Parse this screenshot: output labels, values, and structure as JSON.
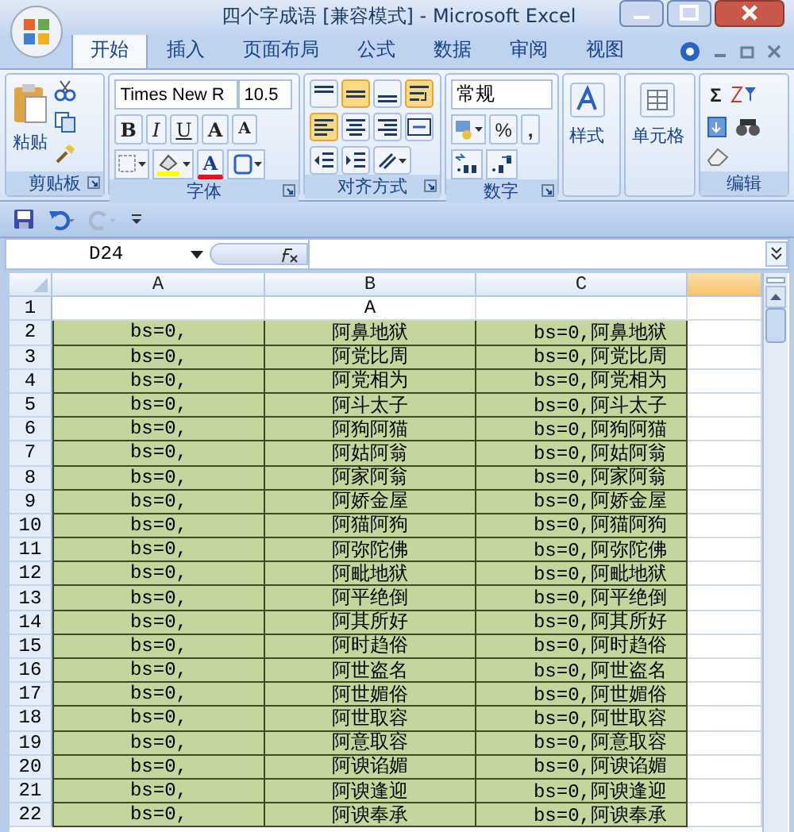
{
  "window": {
    "title": "四个字成语  [兼容模式] - Microsoft Excel"
  },
  "tabs": [
    {
      "label": "开始",
      "selected": true
    },
    {
      "label": "插入",
      "selected": false
    },
    {
      "label": "页面布局",
      "selected": false
    },
    {
      "label": "公式",
      "selected": false
    },
    {
      "label": "数据",
      "selected": false
    },
    {
      "label": "审阅",
      "selected": false
    },
    {
      "label": "视图",
      "selected": false
    }
  ],
  "ribbon": {
    "clipboard": {
      "paste": "粘贴",
      "label": "剪贴板"
    },
    "font": {
      "name": "Times New R",
      "size": "10.5",
      "styles": [
        "B",
        "I",
        "U"
      ],
      "grow": "A",
      "shrink": "A",
      "color_letter": "A",
      "label": "字体"
    },
    "alignment": {
      "buttons": [
        {
          "kind": "top",
          "on": false
        },
        {
          "kind": "middle",
          "on": true
        },
        {
          "kind": "bottom",
          "on": false
        },
        {
          "kind": "wrap",
          "on": true
        },
        {
          "kind": "left",
          "on": true
        },
        {
          "kind": "center",
          "on": false
        },
        {
          "kind": "right",
          "on": false
        },
        {
          "kind": "merge",
          "on": false
        }
      ],
      "label": "对齐方式"
    },
    "number": {
      "format": "常规",
      "percent": "%",
      "comma": ",",
      "label": "数字"
    },
    "styles": {
      "label": "样式"
    },
    "cells": {
      "label": "单元格"
    },
    "editing": {
      "sum": "Σ",
      "label": "编辑"
    }
  },
  "formula_bar": {
    "name_box": "D24"
  },
  "columns": [
    {
      "label": "A",
      "selected": false
    },
    {
      "label": "B",
      "selected": false
    },
    {
      "label": "C",
      "selected": false
    },
    {
      "selected": true
    }
  ],
  "rows": [
    {
      "number": "1",
      "b": "A"
    },
    {
      "number": "2",
      "a": "bs=0,",
      "b": "阿鼻地狱",
      "c": "bs=0,阿鼻地狱"
    },
    {
      "number": "3",
      "a": "bs=0,",
      "b": "阿党比周",
      "c": "bs=0,阿党比周"
    },
    {
      "number": "4",
      "a": "bs=0,",
      "b": "阿党相为",
      "c": "bs=0,阿党相为"
    },
    {
      "number": "5",
      "a": "bs=0,",
      "b": "阿斗太子",
      "c": "bs=0,阿斗太子"
    },
    {
      "number": "6",
      "a": "bs=0,",
      "b": "阿狗阿猫",
      "c": "bs=0,阿狗阿猫"
    },
    {
      "number": "7",
      "a": "bs=0,",
      "b": "阿姑阿翁",
      "c": "bs=0,阿姑阿翁"
    },
    {
      "number": "8",
      "a": "bs=0,",
      "b": "阿家阿翁",
      "c": "bs=0,阿家阿翁"
    },
    {
      "number": "9",
      "a": "bs=0,",
      "b": "阿娇金屋",
      "c": "bs=0,阿娇金屋"
    },
    {
      "number": "10",
      "a": "bs=0,",
      "b": "阿猫阿狗",
      "c": "bs=0,阿猫阿狗"
    },
    {
      "number": "11",
      "a": "bs=0,",
      "b": "阿弥陀佛",
      "c": "bs=0,阿弥陀佛"
    },
    {
      "number": "12",
      "a": "bs=0,",
      "b": "阿毗地狱",
      "c": "bs=0,阿毗地狱"
    },
    {
      "number": "13",
      "a": "bs=0,",
      "b": "阿平绝倒",
      "c": "bs=0,阿平绝倒"
    },
    {
      "number": "14",
      "a": "bs=0,",
      "b": "阿其所好",
      "c": "bs=0,阿其所好"
    },
    {
      "number": "15",
      "a": "bs=0,",
      "b": "阿时趋俗",
      "c": "bs=0,阿时趋俗"
    },
    {
      "number": "16",
      "a": "bs=0,",
      "b": "阿世盗名",
      "c": "bs=0,阿世盗名"
    },
    {
      "number": "17",
      "a": "bs=0,",
      "b": "阿世媚俗",
      "c": "bs=0,阿世媚俗"
    },
    {
      "number": "18",
      "a": "bs=0,",
      "b": "阿世取容",
      "c": "bs=0,阿世取容"
    },
    {
      "number": "19",
      "a": "bs=0,",
      "b": "阿意取容",
      "c": "bs=0,阿意取容"
    },
    {
      "number": "20",
      "a": "bs=0,",
      "b": "阿谀谄媚",
      "c": "bs=0,阿谀谄媚"
    },
    {
      "number": "21",
      "a": "bs=0,",
      "b": "阿谀逢迎",
      "c": "bs=0,阿谀逢迎"
    },
    {
      "number": "22",
      "a": "bs=0,",
      "b": "阿谀奉承",
      "c": "bs=0,阿谀奉承"
    }
  ]
}
